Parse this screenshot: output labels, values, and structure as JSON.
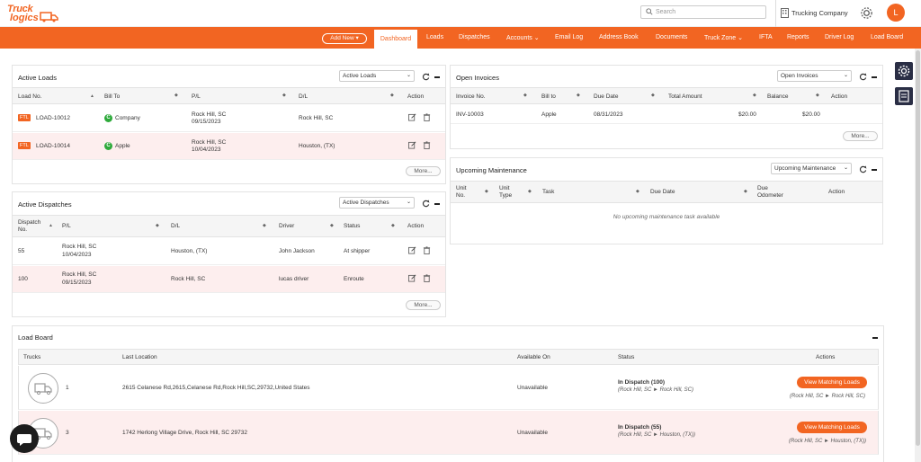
{
  "brand": {
    "logo_line1": "Truck",
    "logo_line2": "logics"
  },
  "header": {
    "search_placeholder": "Search",
    "company": "Trucking Company",
    "avatar_initial": "L"
  },
  "nav": {
    "add_new": "Add New",
    "items": [
      "Dashboard",
      "Loads",
      "Dispatches",
      "Accounts",
      "Email Log",
      "Address Book",
      "Documents",
      "Truck Zone",
      "IFTA",
      "Reports",
      "Driver Log",
      "Load Board"
    ],
    "active": "Dashboard"
  },
  "active_loads": {
    "title": "Active Loads",
    "select": "Active Loads",
    "columns": [
      "Load No.",
      "Bill To",
      "P/L",
      "D/L",
      "Action"
    ],
    "rows": [
      {
        "badge": "FTL",
        "load_no": "LOAD-10012",
        "bill_to_badge": "C",
        "bill_to": "Company",
        "pl_city": "Rock Hill, SC",
        "pl_date": "09/15/2023",
        "dl": "Rock Hill, SC"
      },
      {
        "badge": "FTL",
        "load_no": "LOAD-10014",
        "bill_to_badge": "C",
        "bill_to": "Apple",
        "pl_city": "Rock Hill, SC",
        "pl_date": "10/04/2023",
        "dl": "Houston, (TX)"
      }
    ],
    "more": "More..."
  },
  "active_dispatches": {
    "title": "Active Dispatches",
    "select": "Active Dispatches",
    "columns": [
      "Dispatch",
      "No.",
      "P/L",
      "D/L",
      "Driver",
      "Status",
      "Action"
    ],
    "rows": [
      {
        "no": "55",
        "pl_city": "Rock Hill, SC",
        "pl_date": "10/04/2023",
        "dl": "Houston, (TX)",
        "driver": "John Jackson",
        "status": "At shipper"
      },
      {
        "no": "100",
        "pl_city": "Rock Hill, SC",
        "pl_date": "09/15/2023",
        "dl": "Rock Hill, SC",
        "driver": "lucas driver",
        "status": "Enroute"
      }
    ],
    "more": "More..."
  },
  "open_invoices": {
    "title": "Open Invoices",
    "select": "Open Invoices",
    "columns": [
      "Invoice No.",
      "Bill to",
      "Due Date",
      "Total Amount",
      "Balance",
      "Action"
    ],
    "rows": [
      {
        "invoice": "INV-10003",
        "bill_to": "Apple",
        "due": "08/31/2023",
        "total": "$20.00",
        "balance": "$20.00"
      }
    ],
    "more": "More..."
  },
  "maintenance": {
    "title": "Upcoming Maintenance",
    "select": "Upcoming Maintenance",
    "columns": [
      "Unit",
      "No.",
      "Unit",
      "Type",
      "Task",
      "Due Date",
      "Due",
      "Odometer",
      "Action"
    ],
    "empty": "No upcoming maintenance task available"
  },
  "load_board": {
    "title": "Load Board",
    "columns": [
      "Trucks",
      "Last Location",
      "Available On",
      "Status",
      "Actions"
    ],
    "rows": [
      {
        "truck": "1",
        "location": "2615 Celanese Rd,2615,Celanese Rd,Rock Hill,SC,29732,United States",
        "available": "Unavailable",
        "status": "In Dispatch (100)",
        "route": "(Rock Hill, SC ► Rock Hill, SC)",
        "button": "View Matching Loads",
        "action_route": "(Rock Hill, SC ► Rock Hill, SC)"
      },
      {
        "truck": "3",
        "location": "1742 Herlong Village Drive, Rock Hill, SC 29732",
        "available": "Unavailable",
        "status": "In Dispatch (55)",
        "route": "(Rock Hill, SC ► Houston, (TX))",
        "button": "View Matching Loads",
        "action_route": "(Rock Hill, SC ► Houston, (TX))"
      }
    ]
  },
  "colors": {
    "brand": "#f26522",
    "pink_row": "#fdeeee",
    "badge_green": "#2eaa3b",
    "side_button": "#2a2e45"
  }
}
